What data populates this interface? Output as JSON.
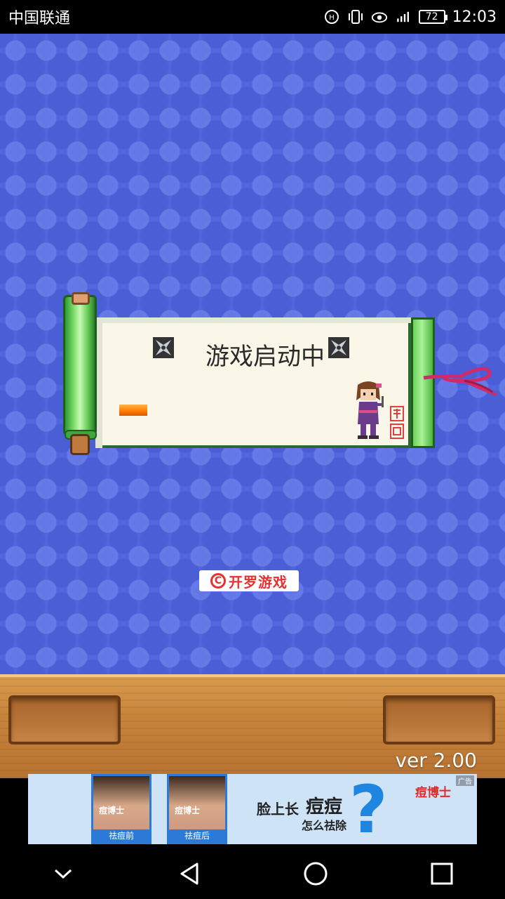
{
  "status_bar": {
    "carrier": "中国联通",
    "battery_level": "72",
    "time": "12:03",
    "icons": [
      "hd-icon",
      "vibrate-icon",
      "eye-comfort-icon",
      "signal-icon",
      "battery-icon"
    ]
  },
  "game": {
    "loading_title": "游戏启动中",
    "loading_progress_percent": 11,
    "publisher_logo_symbol": "C",
    "publisher_logo_text": "开罗游戏",
    "version": "ver 2.00",
    "colors": {
      "background": "#4a5fd6",
      "scroll_green": "#6bd35a",
      "progress": "#ff7a00",
      "wood": "#c6843a"
    }
  },
  "ad": {
    "before_label": "祛痘前",
    "after_label": "祛痘后",
    "photo_brand": "痘博士",
    "headline": "脸上长",
    "headline_big": "痘痘",
    "sub": "怎么祛除",
    "question": "?",
    "brand": "痘博士",
    "tag": "广告"
  },
  "nav_bar": {
    "buttons": [
      "collapse-icon",
      "back-icon",
      "home-icon",
      "recents-icon"
    ]
  }
}
